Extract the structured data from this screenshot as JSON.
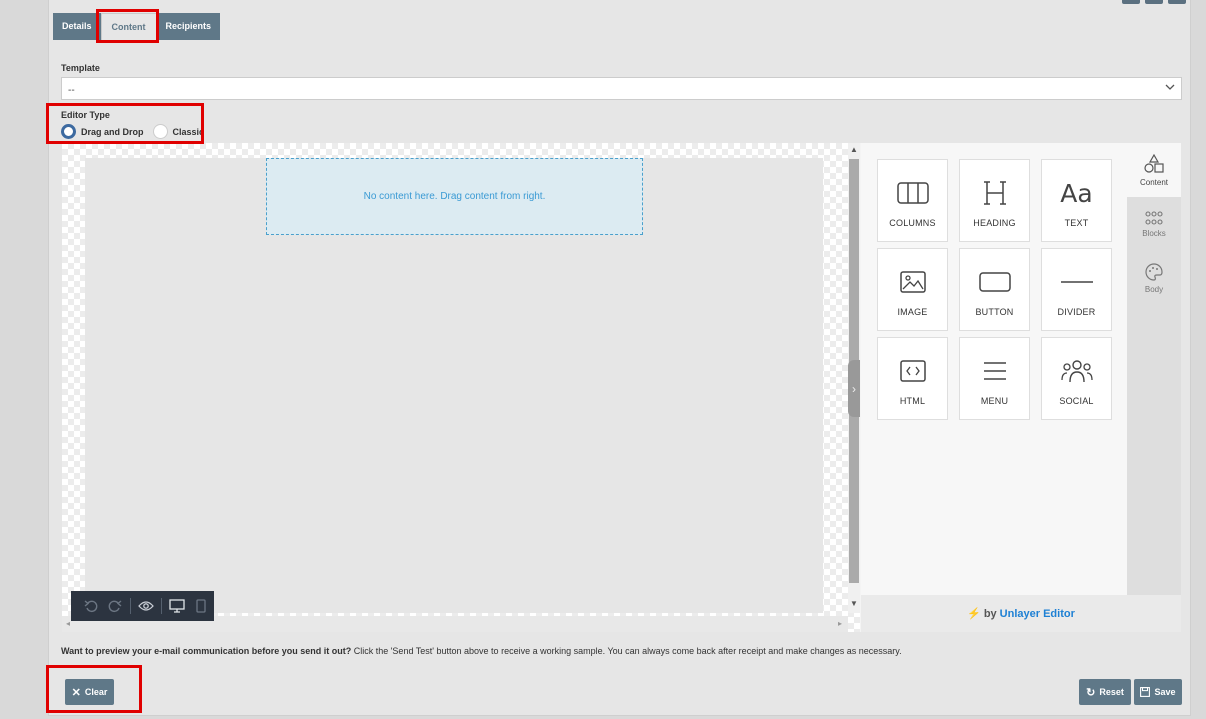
{
  "tabs": [
    {
      "label": "Details"
    },
    {
      "label": "Content"
    },
    {
      "label": "Recipients"
    }
  ],
  "template": {
    "label": "Template",
    "value": "--"
  },
  "editor_type": {
    "label": "Editor Type",
    "options": [
      {
        "label": "Drag and Drop",
        "selected": true
      },
      {
        "label": "Classic",
        "selected": false
      }
    ]
  },
  "canvas": {
    "placeholder": "No content here. Drag content from right."
  },
  "content_tiles": [
    {
      "label": "COLUMNS",
      "icon": "columns-icon"
    },
    {
      "label": "HEADING",
      "icon": "heading-icon"
    },
    {
      "label": "TEXT",
      "icon": "text-icon"
    },
    {
      "label": "IMAGE",
      "icon": "image-icon"
    },
    {
      "label": "BUTTON",
      "icon": "button-icon"
    },
    {
      "label": "DIVIDER",
      "icon": "divider-icon"
    },
    {
      "label": "HTML",
      "icon": "html-icon"
    },
    {
      "label": "MENU",
      "icon": "menu-icon"
    },
    {
      "label": "SOCIAL",
      "icon": "social-icon"
    }
  ],
  "side_tabs": [
    {
      "label": "Content",
      "active": true
    },
    {
      "label": "Blocks",
      "active": false
    },
    {
      "label": "Body",
      "active": false
    }
  ],
  "footer": {
    "by": "by",
    "brand": "Unlayer Editor"
  },
  "help_text": {
    "bold": "Want to preview your e-mail communication before you send it out?",
    "rest": " Click the 'Send Test' button above to receive a working sample. You can always come back after receipt and make changes as necessary."
  },
  "buttons": {
    "clear": "Clear",
    "reset": "Reset",
    "save": "Save"
  },
  "colors": {
    "accent": "#5f7888",
    "highlight": "#e00000",
    "brand": "#1e80d4"
  }
}
